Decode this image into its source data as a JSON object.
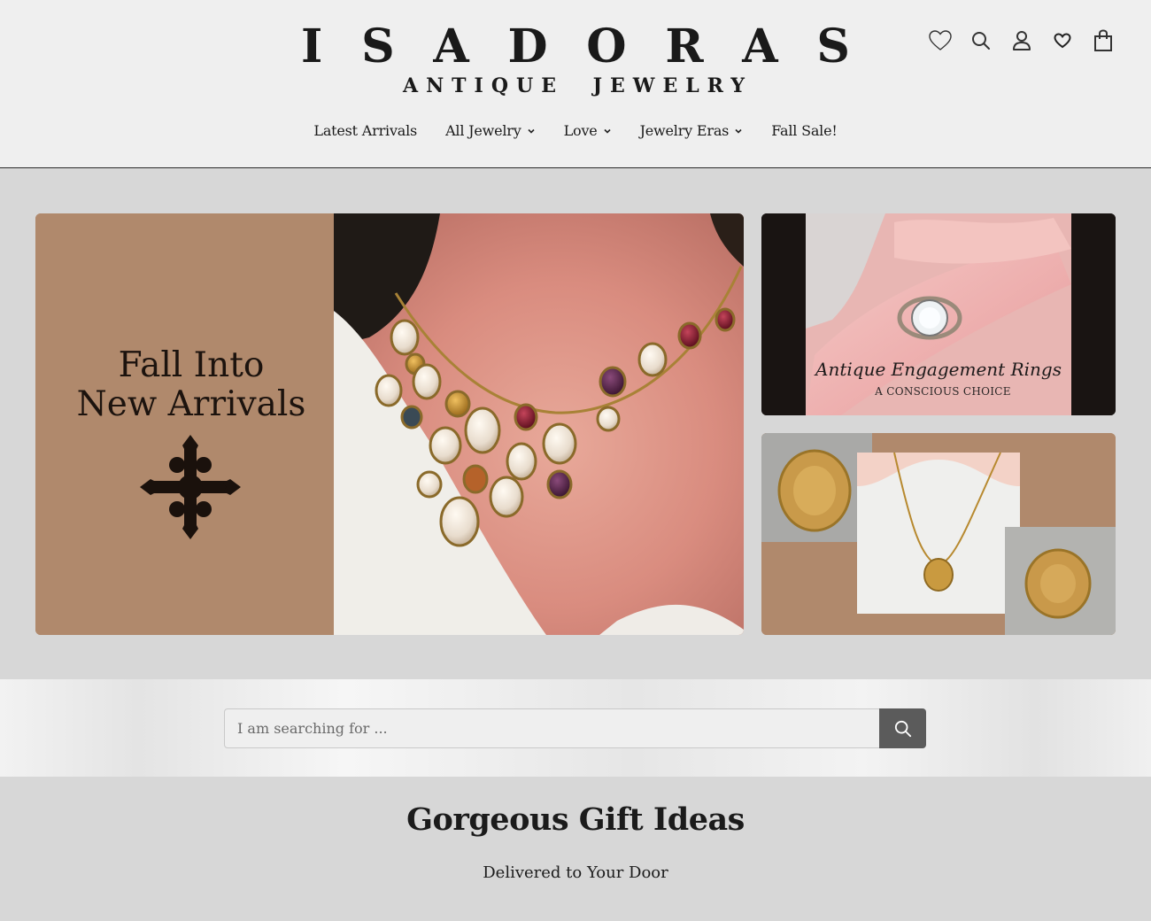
{
  "header": {
    "logo_letters": [
      "I",
      "S",
      "A",
      "D",
      "O",
      "R",
      "A",
      "S"
    ],
    "logo_sub_words": [
      "ANTIQUE",
      "JEWELRY"
    ],
    "icons": [
      "wishlist-heart-icon",
      "search-icon",
      "account-icon",
      "favorites-heart-icon",
      "cart-bag-icon"
    ]
  },
  "nav": {
    "items": [
      {
        "label": "Latest Arrivals",
        "dropdown": false
      },
      {
        "label": "All Jewelry",
        "dropdown": true
      },
      {
        "label": "Love",
        "dropdown": true
      },
      {
        "label": "Jewelry Eras",
        "dropdown": true
      },
      {
        "label": "Fall Sale!",
        "dropdown": false
      }
    ]
  },
  "hero": {
    "main_title_line1": "Fall Into",
    "main_title_line2": "New Arrivals",
    "side_top_title": "Antique Engagement Rings",
    "side_top_subtitle": "A CONSCIOUS CHOICE"
  },
  "search": {
    "placeholder": "I am searching for ..."
  },
  "gift": {
    "title": "Gorgeous Gift Ideas",
    "subtitle": "Delivered to Your Door"
  },
  "colors": {
    "page_bg": "#d7d7d7",
    "header_bg": "#efefef",
    "hero_tan": "#b0896c",
    "search_button": "#5b5b5b",
    "text": "#1a1a1a"
  }
}
